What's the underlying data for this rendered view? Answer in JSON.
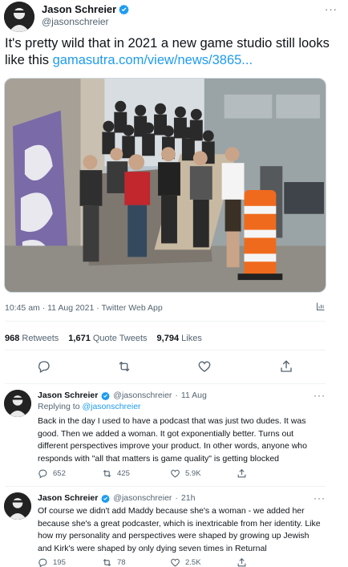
{
  "tweet": {
    "author_name": "Jason Schreier",
    "author_handle": "@jasonschreier",
    "more_label": "···",
    "text": "It's pretty wild that in 2021 a new game studio still looks like this ",
    "link_text": "gamasutra.com/view/news/3865...",
    "timestamp": "10:45 am · 11 Aug 2021 · Twitter Web App",
    "photo_icon": "group-photo",
    "stats": {
      "retweets_count": "968",
      "retweets_label": "Retweets",
      "quotes_count": "1,671",
      "quotes_label": "Quote Tweets",
      "likes_count": "9,794",
      "likes_label": "Likes"
    }
  },
  "replies": [
    {
      "author_name": "Jason Schreier",
      "author_handle": "@jasonschreier",
      "separator": "·",
      "time": "11 Aug",
      "more_label": "···",
      "replying_prefix": "Replying to ",
      "replying_to": "@jasonschreier",
      "text": "Back in the day I used to have a podcast that was just two dudes. It was good. Then we added a woman. It got exponentially better. Turns out different perspectives improve your product. In other words, anyone who responds with \"all that matters is game quality\" is getting blocked",
      "reply_count": "652",
      "retweet_count": "425",
      "like_count": "5.9K"
    },
    {
      "author_name": "Jason Schreier",
      "author_handle": "@jasonschreier",
      "separator": "·",
      "time": "21h",
      "more_label": "···",
      "text": "Of course we didn't add Maddy because she's a woman - we added her because she's a great podcaster, which is inextricable from her identity. Like how my personality and perspectives were shaped by growing up Jewish and Kirk's were shaped by only dying seven times in Returnal",
      "reply_count": "195",
      "retweet_count": "78",
      "like_count": "2.5K"
    }
  ],
  "colors": {
    "accent": "#1d9bf0",
    "text": "#0f1419",
    "secondary": "#536471",
    "divider": "#eff3f4"
  }
}
